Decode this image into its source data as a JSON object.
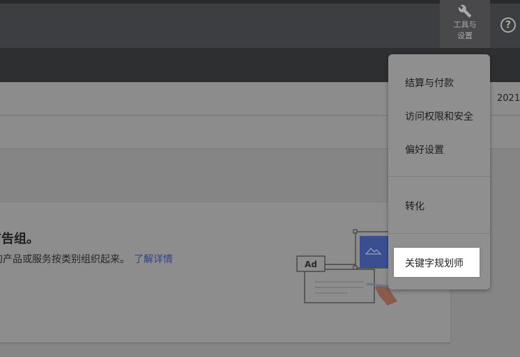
{
  "header": {
    "tools_label_line1": "工具与",
    "tools_label_line2": "设置",
    "help_icon": "?"
  },
  "toolbar": {
    "date_fragment": "2021"
  },
  "card": {
    "title": "广告组。",
    "description": "的产品或服务按类别组织起来。",
    "learn_more": "了解详情",
    "ad_badge": "Ad"
  },
  "menu": {
    "items": [
      {
        "label": "结算与付款"
      },
      {
        "label": "访问权限和安全"
      },
      {
        "label": "偏好设置"
      },
      {
        "label": "转化"
      },
      {
        "label": "关键字规划师"
      }
    ]
  },
  "colors": {
    "highlight": "#ffffff",
    "link": "#2f4386",
    "image_blue": "#3a4f8f"
  }
}
